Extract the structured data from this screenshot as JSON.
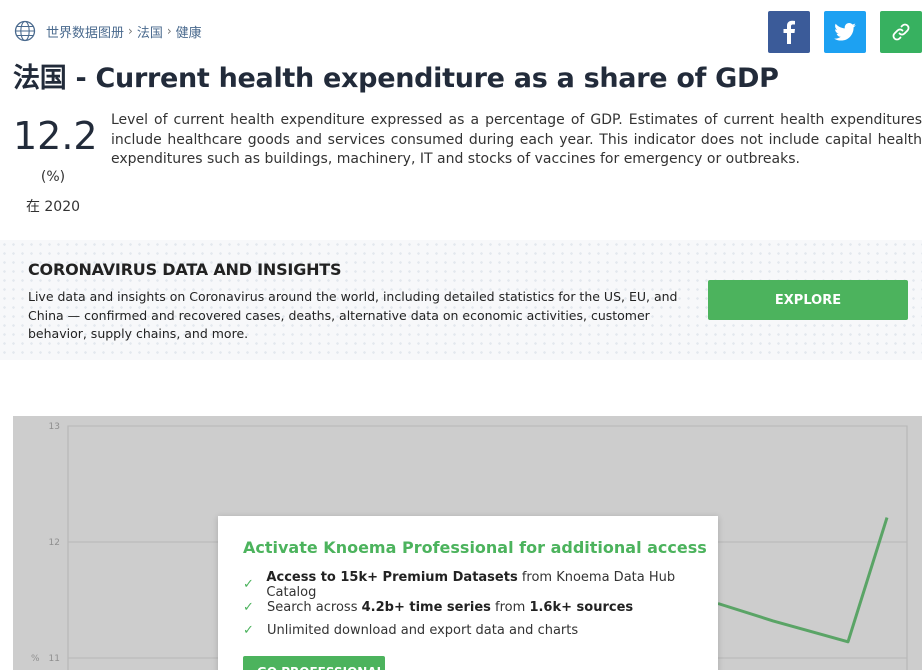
{
  "breadcrumb": {
    "items": [
      "世界数据图册",
      "法国",
      "健康"
    ],
    "separator": "›"
  },
  "share": {
    "facebook_icon": "facebook-icon",
    "twitter_icon": "twitter-icon",
    "link_icon": "link-icon"
  },
  "title": "法国 - Current health expenditure as a share of GDP",
  "kpi": {
    "value": "12.2",
    "unit": "(%)",
    "year": "在 2020"
  },
  "description": "Level of current health expenditure expressed as a percentage of GDP. Estimates of current health expenditures include healthcare goods and services consumed during each year. This indicator does not include capital health expenditures such as buildings, machinery, IT and stocks of vaccines for emergency or outbreaks.",
  "covid": {
    "title": "CORONAVIRUS DATA AND INSIGHTS",
    "text": "Live data and insights on Coronavirus around the world, including detailed statistics for the US, EU, and China — confirmed and recovered cases, deaths, alternative data on economic activities, customer behavior, supply chains, and more.",
    "button": "EXPLORE"
  },
  "chart_data": {
    "type": "line",
    "y_ticks": [
      "13",
      "12",
      "11"
    ],
    "ylabel": "%",
    "ylim": [
      10.5,
      13
    ],
    "series": [
      {
        "values": [
          11.47,
          11.32,
          11.14,
          12.21
        ]
      }
    ]
  },
  "pro": {
    "title": "Activate Knoema Professional for additional access",
    "items": [
      {
        "bold": "Access to 15k+ Premium Datasets",
        "rest": " from Knoema Data Hub Catalog"
      },
      {
        "pre": "Search across ",
        "bold": "4.2b+ time series",
        "mid": " from ",
        "bold2": "1.6k+ sources"
      },
      {
        "rest": "Unlimited download and export data and charts"
      }
    ],
    "button": "GO PROFESSIONAL",
    "colors": {
      "accent": "#4cb35d"
    }
  }
}
